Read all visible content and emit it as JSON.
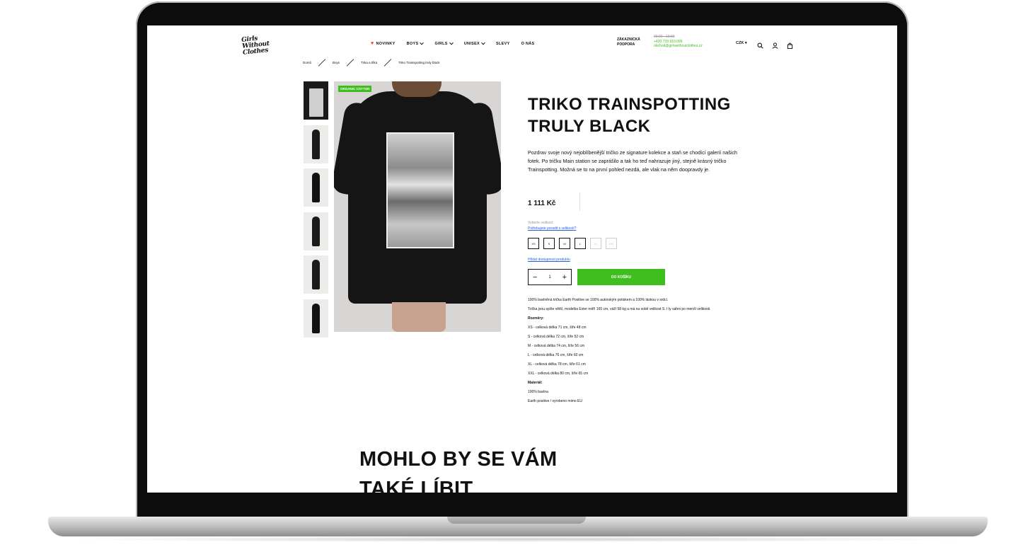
{
  "header": {
    "logo_text": "Girls Without Clothes",
    "nav": [
      {
        "label": "NOVINKY",
        "has_heart": true,
        "has_chevron": false
      },
      {
        "label": "BOYS",
        "has_heart": false,
        "has_chevron": true
      },
      {
        "label": "GIRLS",
        "has_heart": false,
        "has_chevron": true
      },
      {
        "label": "UNISEX",
        "has_heart": false,
        "has_chevron": true
      },
      {
        "label": "SLEVY",
        "has_heart": false,
        "has_chevron": false
      },
      {
        "label": "O NÁS",
        "has_heart": false,
        "has_chevron": false
      }
    ],
    "support_label": "ZÁKAZNICKÁ PODPORA",
    "support_hours": "09:00 - 19:00",
    "support_phone": "+420 739 910 099",
    "support_email": "obchod@girlswithoutclothes.cz",
    "currency": "CZK",
    "icons": [
      "search-icon",
      "user-icon",
      "bag-icon"
    ]
  },
  "breadcrumb": [
    "Domů",
    "Boys",
    "Trika a tílka",
    "Triko Trainspotting truly black"
  ],
  "gallery": {
    "badge": "ORGANIC COTTON",
    "thumb_count": 6
  },
  "product": {
    "title": "TRIKO TRAINSPOTTING TRULY BLACK",
    "description": "Pozdrav svoje nový nejoblíbenější tričko ze signature kolekce a staň se chodící galerií našich fotek. Po tričku Main station se zaprášilo a tak ho teď nahrazuje jiný, stejně krásný tričko Trainspotting. Možná se to na první pohled nezdá, ale vlak na něm doopravdy je.",
    "price": "1 111 Kč",
    "size_label": "Vyberte velikost",
    "size_help": "Potřebujete poradit s velikostí?",
    "sizes": [
      {
        "label": "XS",
        "available": true
      },
      {
        "label": "S",
        "available": true
      },
      {
        "label": "M",
        "available": true
      },
      {
        "label": "L",
        "available": true
      },
      {
        "label": "XL",
        "available": false
      },
      {
        "label": "XXL",
        "available": false
      }
    ],
    "watch_link": "Hlídat dostupnost produktu",
    "quantity": "1",
    "add_to_cart": "DO KOŠÍKU",
    "details": {
      "intro": "100% bavlněná trička Earth Positive se 100% autorským potiskem a 100% láskou v srdci.",
      "fit_note": "Trička jsou spíše větší, modelka Ester měří 165 cm, váží 58 kg a má na sobě velikost S. I ty sáhni po menší velikosti.",
      "sizes_heading": "Rozměry:",
      "size_rows": [
        "XS - celková délka 71 cm, šíře 48 cm",
        "S - celková délka 72 cm, šíře 52 cm",
        "M - celková délka 74 cm, šíře 56 cm",
        "L - celková délka 76 cm, šíře 60 cm",
        "XL - celková délka 78 cm, šíře 61 cm",
        "XXL - celková délka 80 cm, šíře 65 cm"
      ],
      "material_heading": "Materiál:",
      "material_rows": [
        "100% bavlna",
        "Earth positive / vyrobeno mimo EU"
      ]
    }
  },
  "related": {
    "title_line1": "MOHLO BY SE VÁM",
    "title_line2": "TAKÉ LÍBIT"
  },
  "colors": {
    "accent": "#3fbf1f",
    "link": "#2a5de0",
    "heart": "#e0372b"
  }
}
